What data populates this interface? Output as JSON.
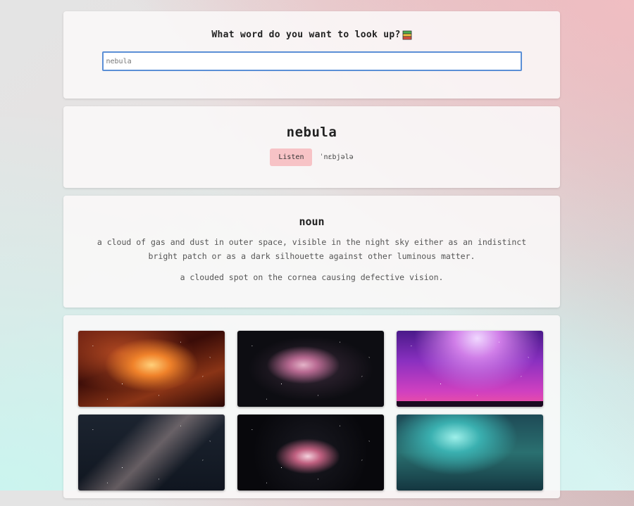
{
  "search": {
    "prompt": "What word do you want to look up?",
    "prompt_icon": "books-icon",
    "value": "nebula"
  },
  "entry": {
    "word": "nebula",
    "listen_label": "Listen",
    "phonetic": "ˈnɛbjələ"
  },
  "meaning": {
    "part_of_speech": "noun",
    "definitions": [
      "a cloud of gas and dust in outer space, visible in the night sky either as an indistinct bright patch or as a dark silhouette against other luminous matter.",
      "a clouded spot on the cornea causing defective vision."
    ]
  },
  "gallery": {
    "image_subjects": [
      "orange-nebula",
      "orion-nebula",
      "purple-milky-way",
      "milky-way-band",
      "orion-nebula-dark",
      "aurora"
    ]
  },
  "colors": {
    "listen_button": "#f7c3c6",
    "input_border": "#5b8fd6"
  }
}
